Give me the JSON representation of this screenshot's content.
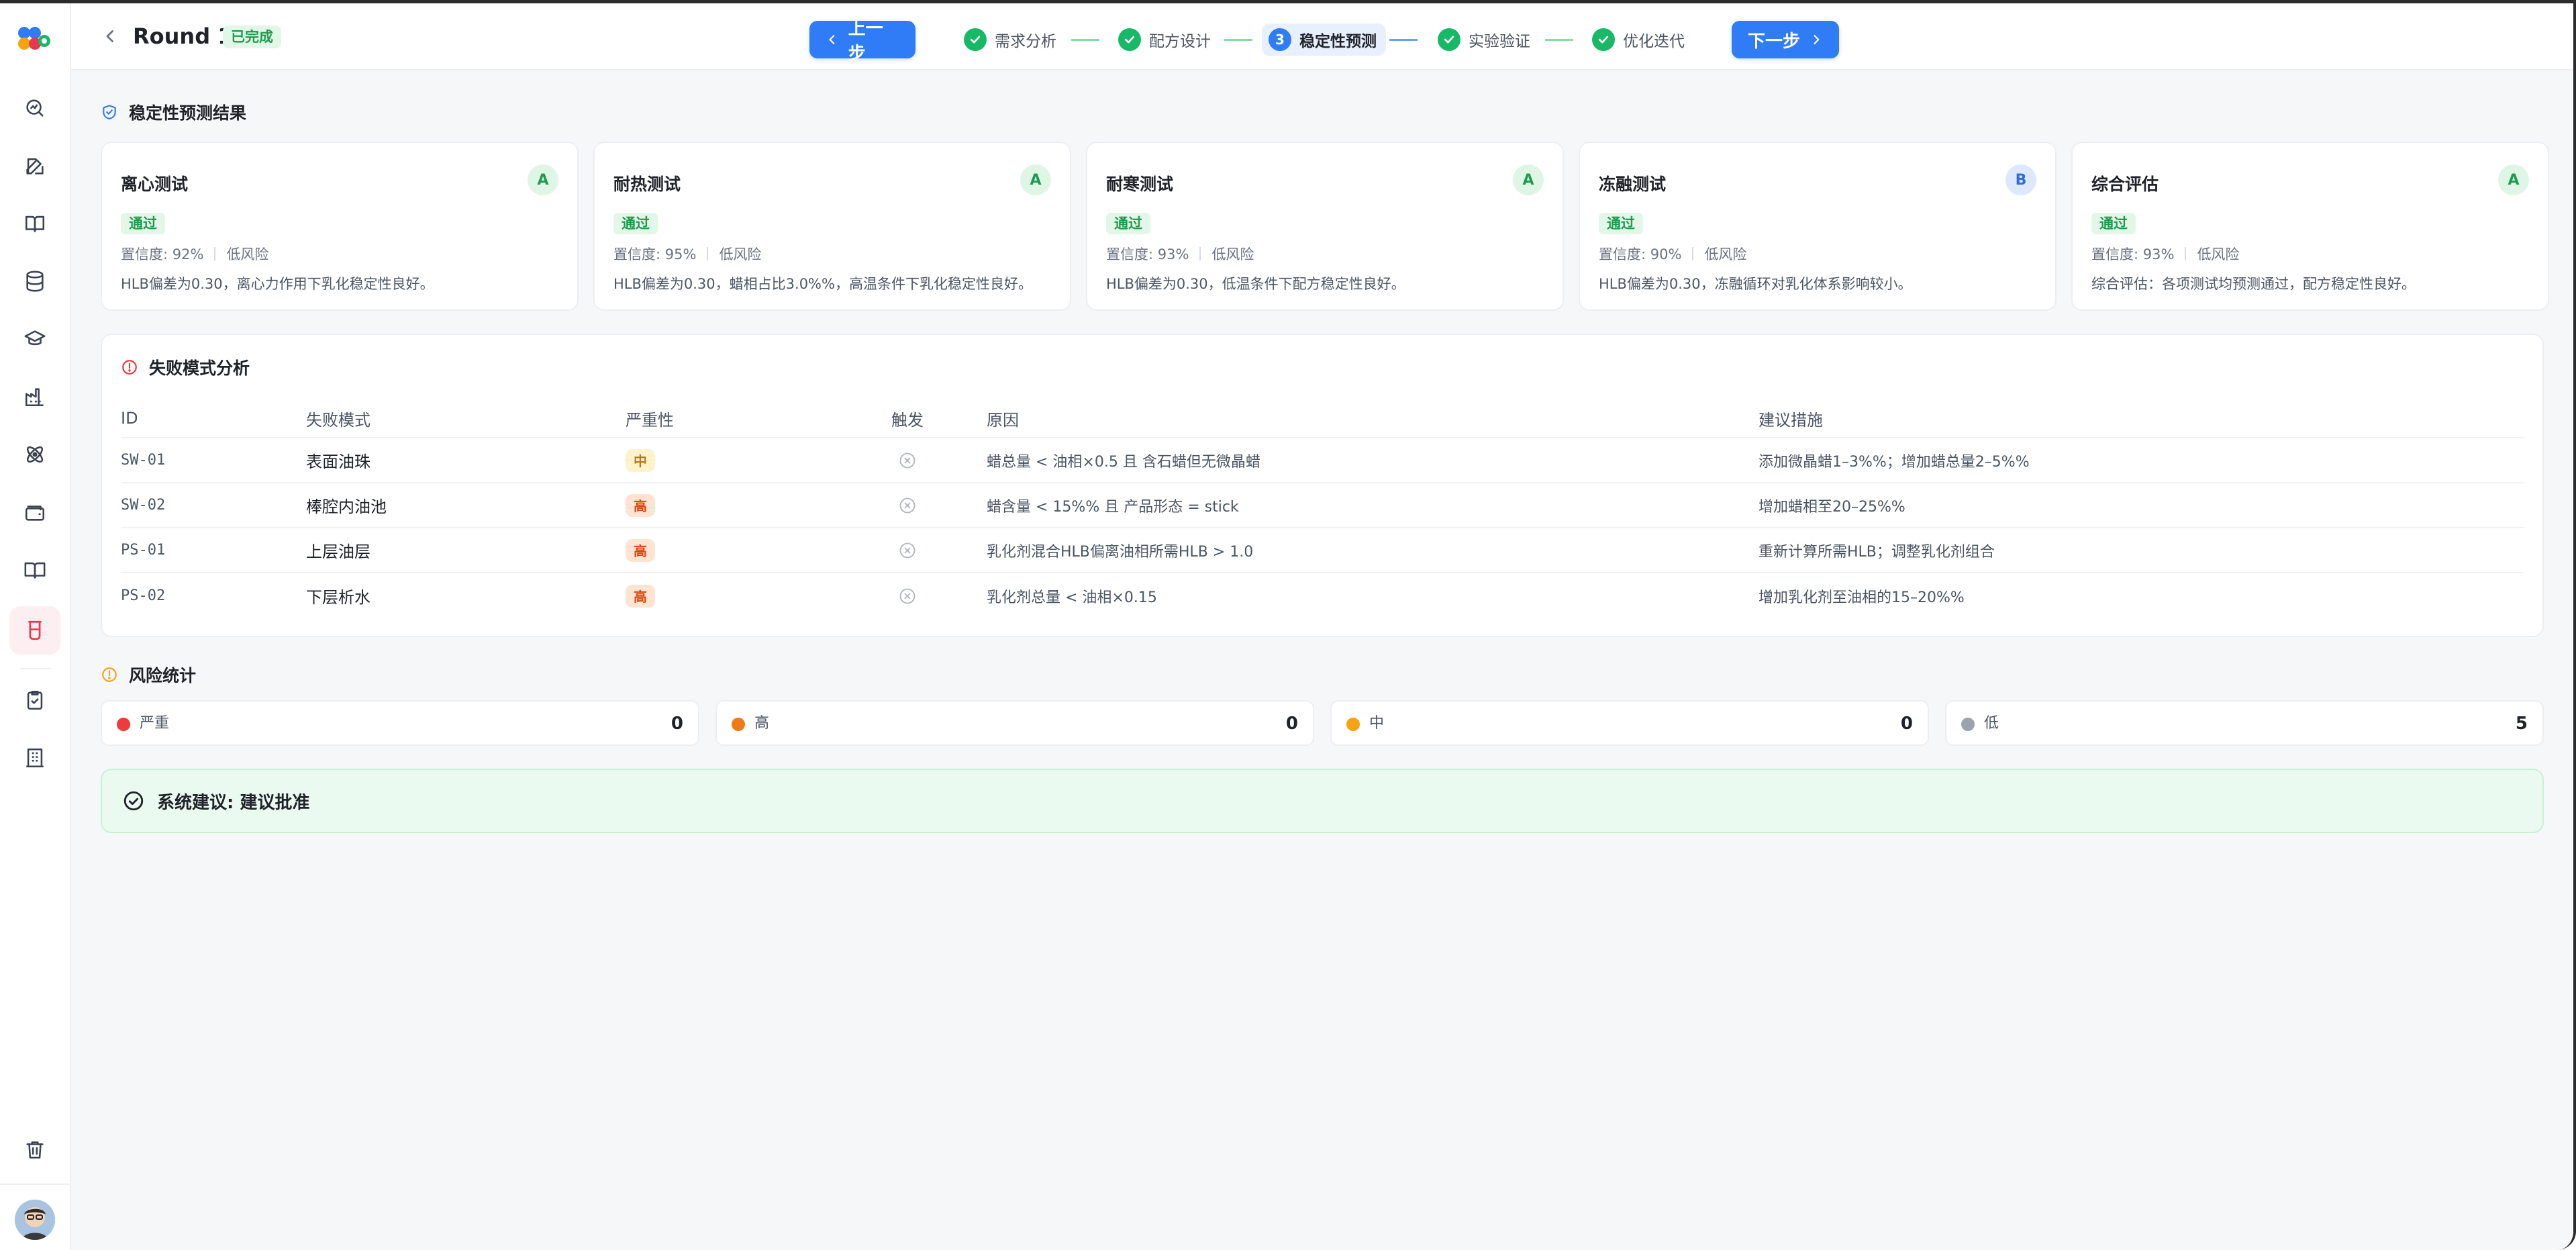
{
  "colors": {
    "accent": "#2f7cf6",
    "success": "#17b866",
    "sidebar_active": "#e6394f",
    "risk_critical": "#ef3b3b",
    "risk_high": "#f07a1a",
    "risk_mid": "#f5a313",
    "risk_low": "#9ca3af"
  },
  "header": {
    "title": "Round 1",
    "status": "已完成",
    "prev_label": "上一步",
    "next_label": "下一步",
    "steps": [
      {
        "label": "需求分析",
        "state": "done"
      },
      {
        "label": "配方设计",
        "state": "done"
      },
      {
        "label": "稳定性预测",
        "state": "current",
        "number": "3"
      },
      {
        "label": "实验验证",
        "state": "done"
      },
      {
        "label": "优化迭代",
        "state": "done"
      }
    ]
  },
  "stability": {
    "title": "稳定性预测结果",
    "cards": [
      {
        "title": "离心测试",
        "grade": "A",
        "status": "通过",
        "confidence": "置信度: 92%",
        "risk": "低风险",
        "desc": "HLB偏差为0.30，离心力作用下乳化稳定性良好。"
      },
      {
        "title": "耐热测试",
        "grade": "A",
        "status": "通过",
        "confidence": "置信度: 95%",
        "risk": "低风险",
        "desc": "HLB偏差为0.30，蜡相占比3.0%%，高温条件下乳化稳定性良好。"
      },
      {
        "title": "耐寒测试",
        "grade": "A",
        "status": "通过",
        "confidence": "置信度: 93%",
        "risk": "低风险",
        "desc": "HLB偏差为0.30，低温条件下配方稳定性良好。"
      },
      {
        "title": "冻融测试",
        "grade": "B",
        "status": "通过",
        "confidence": "置信度: 90%",
        "risk": "低风险",
        "desc": "HLB偏差为0.30，冻融循环对乳化体系影响较小。"
      },
      {
        "title": "综合评估",
        "grade": "A",
        "status": "通过",
        "confidence": "置信度: 93%",
        "risk": "低风险",
        "desc": "综合评估：各项测试均预测通过，配方稳定性良好。"
      }
    ]
  },
  "failure_modes": {
    "title": "失败模式分析",
    "columns": {
      "id": "ID",
      "mode": "失败模式",
      "severity": "严重性",
      "trigger": "触发",
      "cause": "原因",
      "action": "建议措施"
    },
    "rows": [
      {
        "id": "SW-01",
        "mode": "表面油珠",
        "severity": "中",
        "cause": "蜡总量 < 油相×0.5 且 含石蜡但无微晶蜡",
        "action": "添加微晶蜡1–3%%；增加蜡总量2–5%%"
      },
      {
        "id": "SW-02",
        "mode": "棒腔内油池",
        "severity": "高",
        "cause": "蜡含量 < 15%% 且 产品形态 = stick",
        "action": "增加蜡相至20–25%%"
      },
      {
        "id": "PS-01",
        "mode": "上层油层",
        "severity": "高",
        "cause": "乳化剂混合HLB偏离油相所需HLB > 1.0",
        "action": "重新计算所需HLB；调整乳化剂组合"
      },
      {
        "id": "PS-02",
        "mode": "下层析水",
        "severity": "高",
        "cause": "乳化剂总量 < 油相×0.15",
        "action": "增加乳化剂至油相的15–20%%"
      }
    ]
  },
  "risk_stats": {
    "title": "风险统计",
    "items": [
      {
        "label": "严重",
        "count": "0"
      },
      {
        "label": "高",
        "count": "0"
      },
      {
        "label": "中",
        "count": "0"
      },
      {
        "label": "低",
        "count": "5"
      }
    ]
  },
  "advice": {
    "text": "系统建议: 建议批准"
  },
  "sidebar": {
    "items": [
      {
        "icon": "search-analytics-icon"
      },
      {
        "icon": "edit-icon"
      },
      {
        "icon": "book-open-icon"
      },
      {
        "icon": "database-icon"
      },
      {
        "icon": "graduation-cap-icon"
      },
      {
        "icon": "factory-icon"
      },
      {
        "icon": "atom-icon"
      },
      {
        "icon": "wallet-icon"
      },
      {
        "icon": "notebook-icon"
      },
      {
        "icon": "beaker-icon"
      },
      {
        "icon": "clipboard-check-icon"
      },
      {
        "icon": "building-icon"
      },
      {
        "icon": "trash-icon"
      }
    ]
  }
}
